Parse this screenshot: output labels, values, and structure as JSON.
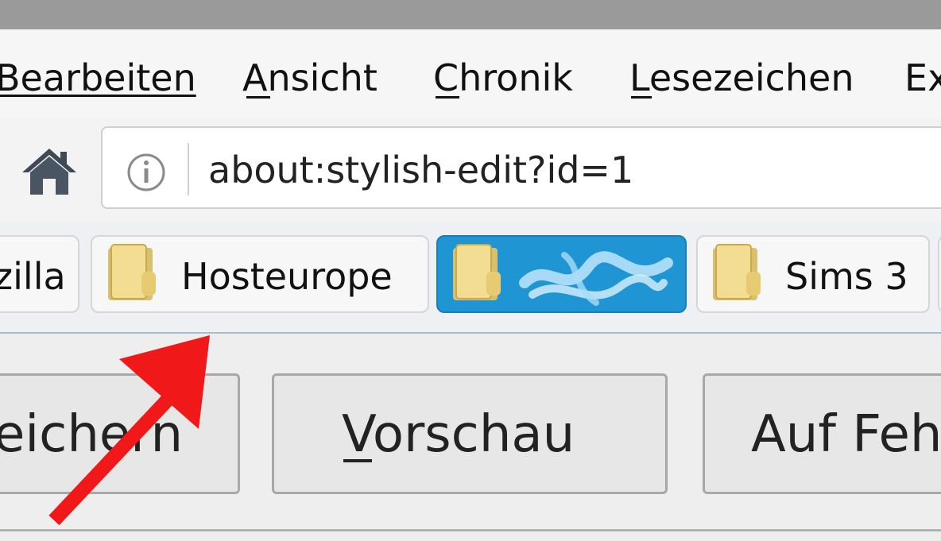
{
  "menubar": {
    "items": [
      {
        "label": "Bearbeiten"
      },
      {
        "label": "Ansicht"
      },
      {
        "label": "Chronik"
      },
      {
        "label": "Lesezeichen"
      },
      {
        "label": "Ex"
      }
    ]
  },
  "navbar": {
    "home_icon": "home-icon",
    "info_icon": "info-icon",
    "url": "about:stylish-edit?id=1"
  },
  "bookmarks": {
    "items": [
      {
        "label": "zilla"
      },
      {
        "label": "Hosteurope"
      },
      {
        "label": ""
      },
      {
        "label": "Sims 3"
      }
    ],
    "active_color": "#1f95d3"
  },
  "editor": {
    "buttons": [
      {
        "label": "eichern"
      },
      {
        "label": "Vorschau"
      },
      {
        "label": "Auf Feh"
      }
    ]
  },
  "annotation": {
    "arrow_color": "#f01818"
  }
}
